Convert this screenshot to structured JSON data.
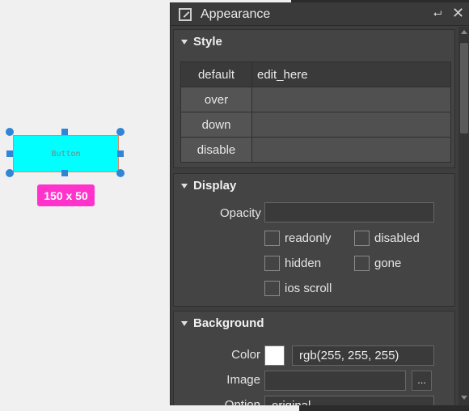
{
  "canvas": {
    "button_text": "Button",
    "size_badge": "150 x 50",
    "accent_color": "#00ffff",
    "badge_color": "#ff33cc"
  },
  "panel": {
    "title": "Appearance",
    "icons": {
      "title": "edit-square-icon",
      "pin": "pin-icon",
      "close": "close-icon"
    },
    "style": {
      "header": "Style",
      "rows": [
        {
          "state": "default",
          "value": "edit_here"
        },
        {
          "state": "over",
          "value": ""
        },
        {
          "state": "down",
          "value": ""
        },
        {
          "state": "disable",
          "value": ""
        }
      ]
    },
    "display": {
      "header": "Display",
      "opacity_label": "Opacity",
      "opacity_value": "",
      "checkboxes": [
        {
          "label": "readonly",
          "checked": false
        },
        {
          "label": "disabled",
          "checked": false
        },
        {
          "label": "hidden",
          "checked": false
        },
        {
          "label": "gone",
          "checked": false
        },
        {
          "label": "ios scroll",
          "checked": false
        }
      ]
    },
    "background": {
      "header": "Background",
      "color_label": "Color",
      "color_value": "rgb(255, 255, 255)",
      "swatch_color": "#ffffff",
      "image_label": "Image",
      "image_value": "",
      "image_button": "...",
      "option_label": "Option",
      "option_value": "original"
    }
  }
}
